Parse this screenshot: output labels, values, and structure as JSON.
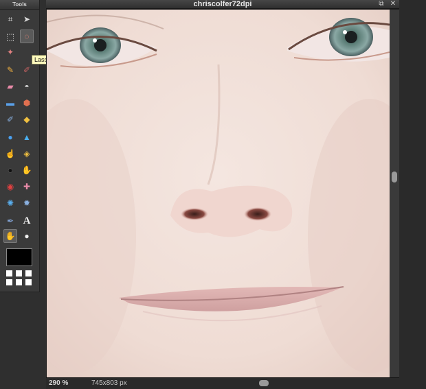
{
  "tools_panel": {
    "title": "Tools",
    "tools": [
      {
        "name": "crop-icon",
        "glyph": "⌗"
      },
      {
        "name": "move-icon",
        "glyph": "➤"
      },
      {
        "name": "marquee-icon",
        "glyph": "⬚"
      },
      {
        "name": "lasso-icon",
        "glyph": "◌"
      },
      {
        "name": "magic-wand-icon",
        "glyph": "✦"
      },
      {
        "name": "pencil-icon",
        "glyph": "✎"
      },
      {
        "name": "brush-icon",
        "glyph": "🖌"
      },
      {
        "name": "eraser-icon",
        "glyph": "▰"
      },
      {
        "name": "paint-bucket-icon",
        "glyph": "⛽"
      },
      {
        "name": "gradient-icon",
        "glyph": "▭"
      },
      {
        "name": "clone-stamp-icon",
        "glyph": "⬢"
      },
      {
        "name": "color-replace-icon",
        "glyph": "✐"
      },
      {
        "name": "shape-icon",
        "glyph": "◆"
      },
      {
        "name": "blur-icon",
        "glyph": "💧"
      },
      {
        "name": "sharpen-icon",
        "glyph": "▲"
      },
      {
        "name": "smudge-icon",
        "glyph": "☝"
      },
      {
        "name": "sponge-icon",
        "glyph": "◈"
      },
      {
        "name": "dodge-icon",
        "glyph": "●"
      },
      {
        "name": "burn-icon",
        "glyph": "✋"
      },
      {
        "name": "red-eye-icon",
        "glyph": "👁"
      },
      {
        "name": "spot-heal-icon",
        "glyph": "✚"
      },
      {
        "name": "bloat-icon",
        "glyph": "✺"
      },
      {
        "name": "pinch-icon",
        "glyph": "✹"
      },
      {
        "name": "color-picker-icon",
        "glyph": "✒"
      },
      {
        "name": "type-icon",
        "glyph": "A"
      },
      {
        "name": "hand-icon",
        "glyph": "✋"
      },
      {
        "name": "zoom-icon",
        "glyph": "🔍"
      }
    ],
    "active_tool": "lasso-icon",
    "tooltip": "Lasso tool (L)",
    "foreground_color": "#000000"
  },
  "document": {
    "title": "chriscolfer72dpi",
    "zoom": "290",
    "zoom_unit": "%",
    "dimensions": "745x803 px"
  },
  "colors": {
    "panel_bg": "#3a3a3a",
    "tooltip_bg": "#fffbbd",
    "skin": "#efe0da"
  }
}
